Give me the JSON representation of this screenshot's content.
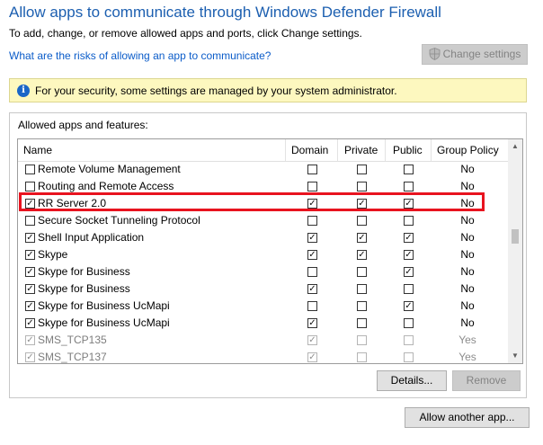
{
  "header": {
    "title": "Allow apps to communicate through Windows Defender Firewall",
    "subtitle": "To add, change, or remove allowed apps and ports, click Change settings.",
    "risk_link": "What are the risks of allowing an app to communicate?",
    "change_settings": "Change settings"
  },
  "banner": {
    "text": "For your security, some settings are managed by your system administrator."
  },
  "group": {
    "label": "Allowed apps and features:"
  },
  "table": {
    "columns": {
      "name": "Name",
      "domain": "Domain",
      "private": "Private",
      "public": "Public",
      "group_policy": "Group Policy"
    },
    "rows": [
      {
        "name": "Remote Volume Management",
        "enabled": false,
        "domain": false,
        "private": false,
        "public": false,
        "gp": "No",
        "dim": false
      },
      {
        "name": "Routing and Remote Access",
        "enabled": false,
        "domain": false,
        "private": false,
        "public": false,
        "gp": "No",
        "dim": false
      },
      {
        "name": "RR Server 2.0",
        "enabled": true,
        "domain": true,
        "private": true,
        "public": true,
        "gp": "No",
        "dim": false
      },
      {
        "name": "Secure Socket Tunneling Protocol",
        "enabled": false,
        "domain": false,
        "private": false,
        "public": false,
        "gp": "No",
        "dim": false
      },
      {
        "name": "Shell Input Application",
        "enabled": true,
        "domain": true,
        "private": true,
        "public": true,
        "gp": "No",
        "dim": false
      },
      {
        "name": "Skype",
        "enabled": true,
        "domain": true,
        "private": true,
        "public": true,
        "gp": "No",
        "dim": false
      },
      {
        "name": "Skype for Business",
        "enabled": true,
        "domain": false,
        "private": false,
        "public": true,
        "gp": "No",
        "dim": false
      },
      {
        "name": "Skype for Business",
        "enabled": true,
        "domain": true,
        "private": false,
        "public": false,
        "gp": "No",
        "dim": false
      },
      {
        "name": "Skype for Business UcMapi",
        "enabled": true,
        "domain": false,
        "private": false,
        "public": true,
        "gp": "No",
        "dim": false
      },
      {
        "name": "Skype for Business UcMapi",
        "enabled": true,
        "domain": true,
        "private": false,
        "public": false,
        "gp": "No",
        "dim": false
      },
      {
        "name": "SMS_TCP135",
        "enabled": true,
        "domain": true,
        "private": false,
        "public": false,
        "gp": "Yes",
        "dim": true
      },
      {
        "name": "SMS_TCP137",
        "enabled": true,
        "domain": true,
        "private": false,
        "public": false,
        "gp": "Yes",
        "dim": true
      }
    ]
  },
  "buttons": {
    "details": "Details...",
    "remove": "Remove",
    "allow_another": "Allow another app..."
  },
  "colors": {
    "title": "#1c5fb0",
    "link": "#0b5cc9",
    "banner": "#fdf8bf",
    "highlight": "#e8131f"
  },
  "icons": {
    "shield": "uac-shield-icon",
    "info": "info-icon"
  }
}
